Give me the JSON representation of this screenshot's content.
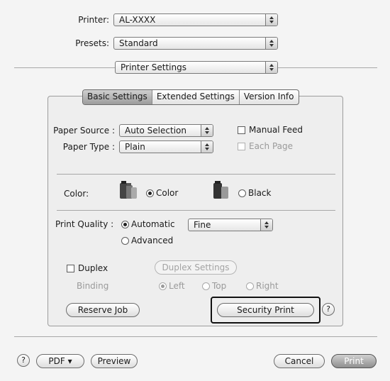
{
  "header": {
    "printer_label": "Printer:",
    "printer_value": "AL-XXXX",
    "presets_label": "Presets:",
    "presets_value": "Standard",
    "panel_value": "Printer Settings"
  },
  "tabs": [
    {
      "label": "Basic Settings",
      "active": true
    },
    {
      "label": "Extended Settings",
      "active": false
    },
    {
      "label": "Version Info",
      "active": false
    }
  ],
  "paper": {
    "source_label": "Paper Source :",
    "source_value": "Auto Selection",
    "type_label": "Paper Type :",
    "type_value": "Plain",
    "manual_feed_label": "Manual Feed",
    "each_page_label": "Each Page"
  },
  "color": {
    "label": "Color:",
    "color_option": "Color",
    "black_option": "Black",
    "selected": "Color"
  },
  "quality": {
    "label": "Print Quality :",
    "automatic_option": "Automatic",
    "advanced_option": "Advanced",
    "level_value": "Fine",
    "selected": "Automatic"
  },
  "duplex": {
    "checkbox_label": "Duplex",
    "settings_button": "Duplex Settings",
    "binding_label": "Binding",
    "left_option": "Left",
    "top_option": "Top",
    "right_option": "Right",
    "selected": "Left"
  },
  "actions": {
    "reserve_job": "Reserve Job",
    "security_print": "Security Print",
    "help": "?"
  },
  "footer": {
    "help": "?",
    "pdf": "PDF ▾",
    "preview": "Preview",
    "cancel": "Cancel",
    "print": "Print"
  }
}
